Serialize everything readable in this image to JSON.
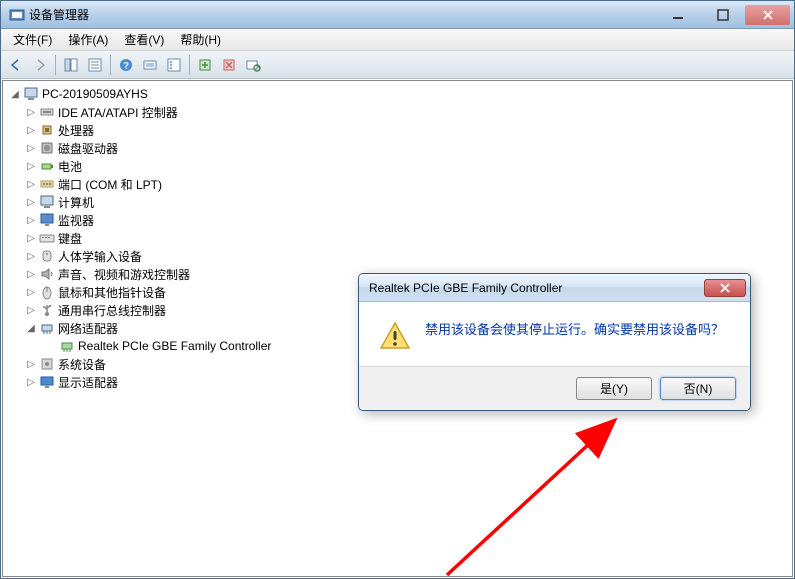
{
  "window": {
    "title": "设备管理器"
  },
  "menus": {
    "file": "文件(F)",
    "action": "操作(A)",
    "view": "查看(V)",
    "help": "帮助(H)"
  },
  "tree": {
    "root": "PC-20190509AYHS",
    "items": [
      {
        "label": "IDE ATA/ATAPI 控制器",
        "icon": "ide"
      },
      {
        "label": "处理器",
        "icon": "cpu"
      },
      {
        "label": "磁盘驱动器",
        "icon": "disk"
      },
      {
        "label": "电池",
        "icon": "battery"
      },
      {
        "label": "端口 (COM 和 LPT)",
        "icon": "port"
      },
      {
        "label": "计算机",
        "icon": "computer"
      },
      {
        "label": "监视器",
        "icon": "monitor"
      },
      {
        "label": "键盘",
        "icon": "keyboard"
      },
      {
        "label": "人体学输入设备",
        "icon": "hid"
      },
      {
        "label": "声音、视频和游戏控制器",
        "icon": "sound"
      },
      {
        "label": "鼠标和其他指针设备",
        "icon": "mouse"
      },
      {
        "label": "通用串行总线控制器",
        "icon": "usb"
      },
      {
        "label": "网络适配器",
        "icon": "network",
        "expanded": true,
        "children": [
          {
            "label": "Realtek PCIe GBE Family Controller",
            "icon": "nic"
          }
        ]
      },
      {
        "label": "系统设备",
        "icon": "system"
      },
      {
        "label": "显示适配器",
        "icon": "display"
      }
    ]
  },
  "dialog": {
    "title": "Realtek PCIe GBE Family Controller",
    "message": "禁用该设备会使其停止运行。确实要禁用该设备吗？",
    "yes": "是(Y)",
    "no": "否(N)"
  }
}
